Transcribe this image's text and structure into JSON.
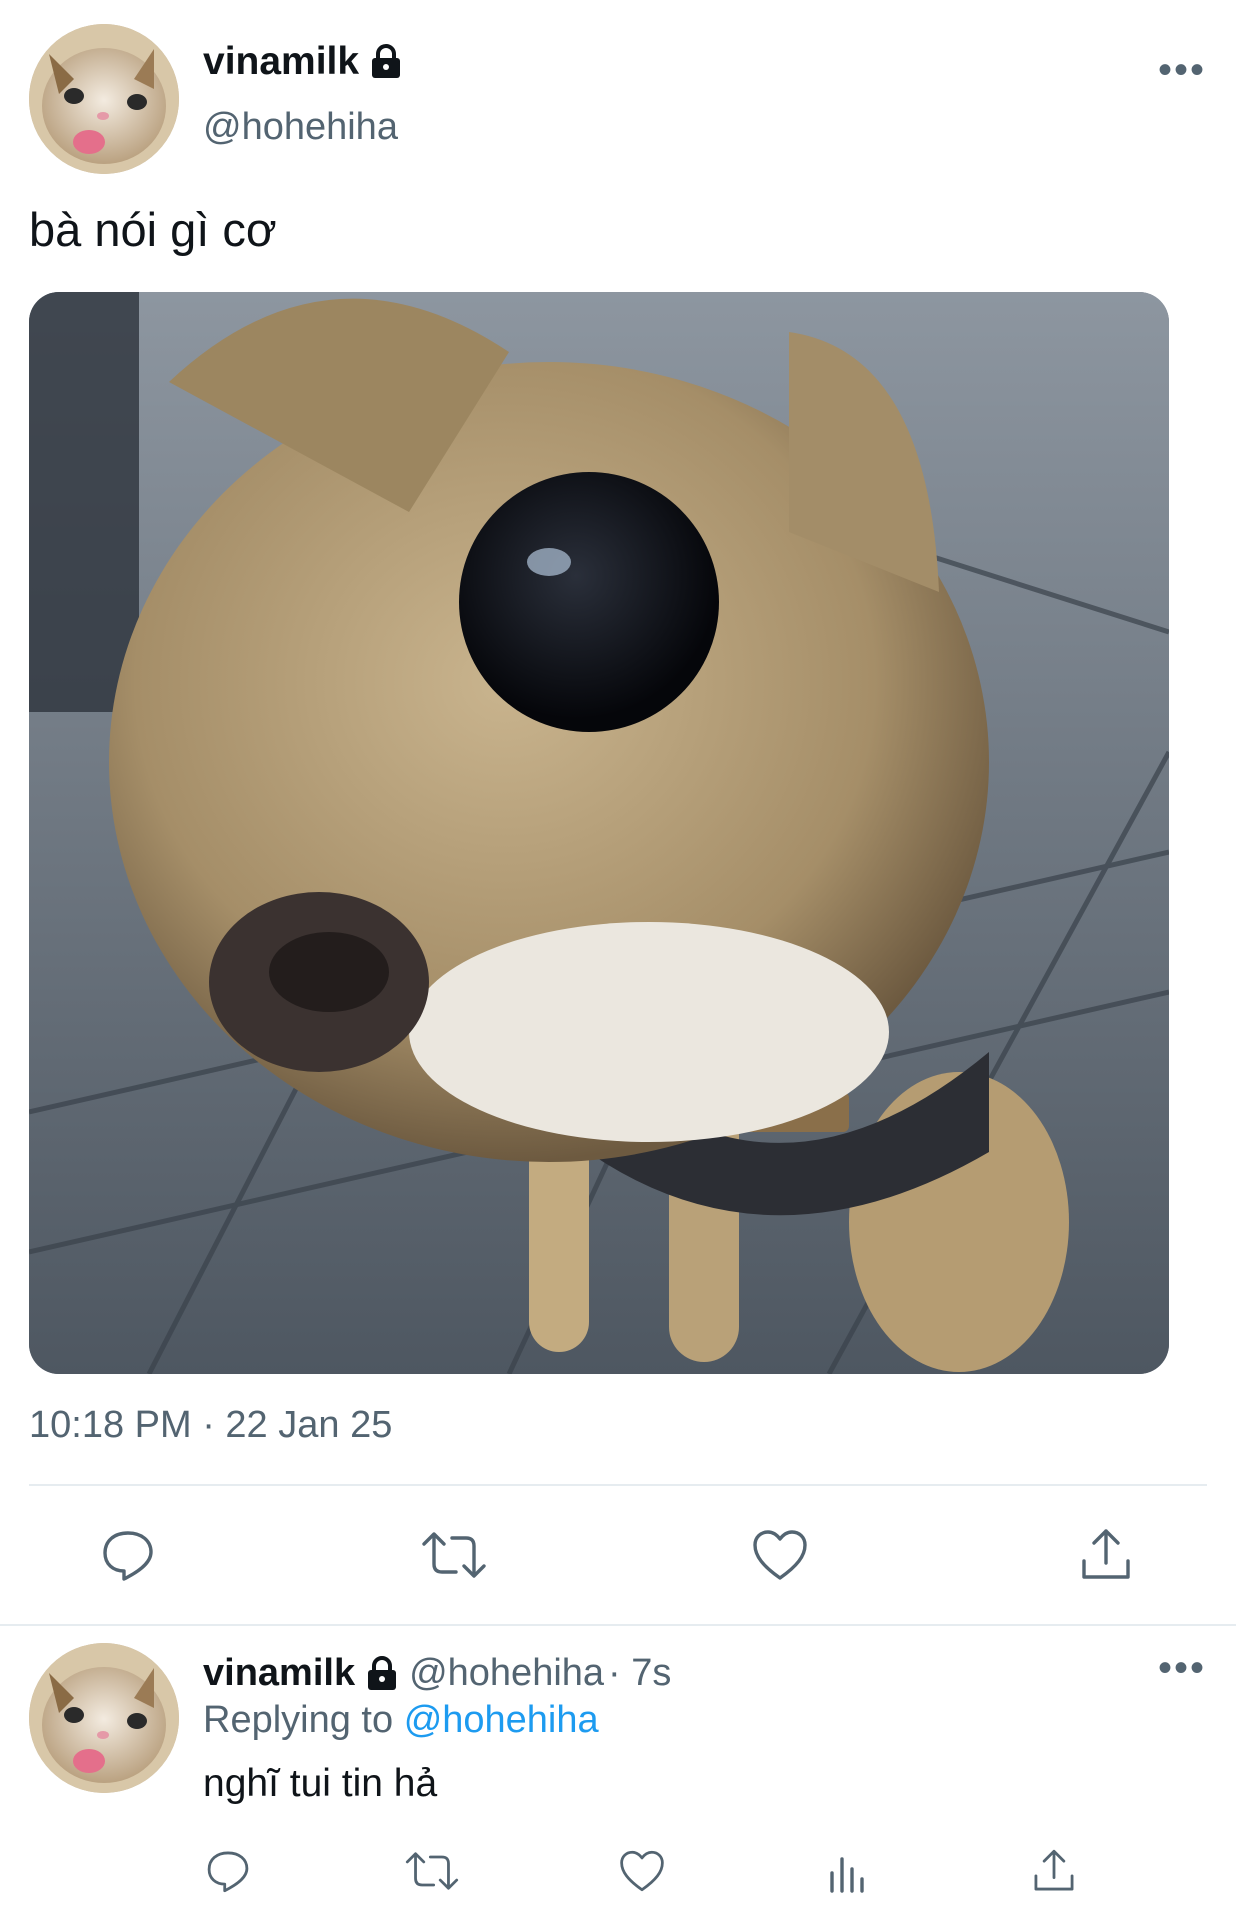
{
  "tweet": {
    "display_name": "vinamilk",
    "handle": "@hohehiha",
    "text": "bà nói gì cơ",
    "timestamp": "10:18 PM · 22 Jan 25",
    "avatar_icon": "cat-avatar",
    "media_description_icon": "dog-photo",
    "actions": [
      "reply-icon",
      "retweet-icon",
      "like-icon",
      "share-icon"
    ]
  },
  "reply": {
    "display_name": "vinamilk",
    "handle": "@hohehiha",
    "age": "· 7s",
    "replying_prefix": "Replying to",
    "replying_to": "@hohehiha",
    "text": "nghĩ tui tin hả",
    "actions": [
      "reply-icon",
      "retweet-icon",
      "like-icon",
      "analytics-icon",
      "share-icon"
    ]
  },
  "more_label": "•••",
  "colors": {
    "accent": "#1d9bf0",
    "muted": "#536471",
    "text": "#0f1419",
    "divider": "#e6ecf0"
  }
}
